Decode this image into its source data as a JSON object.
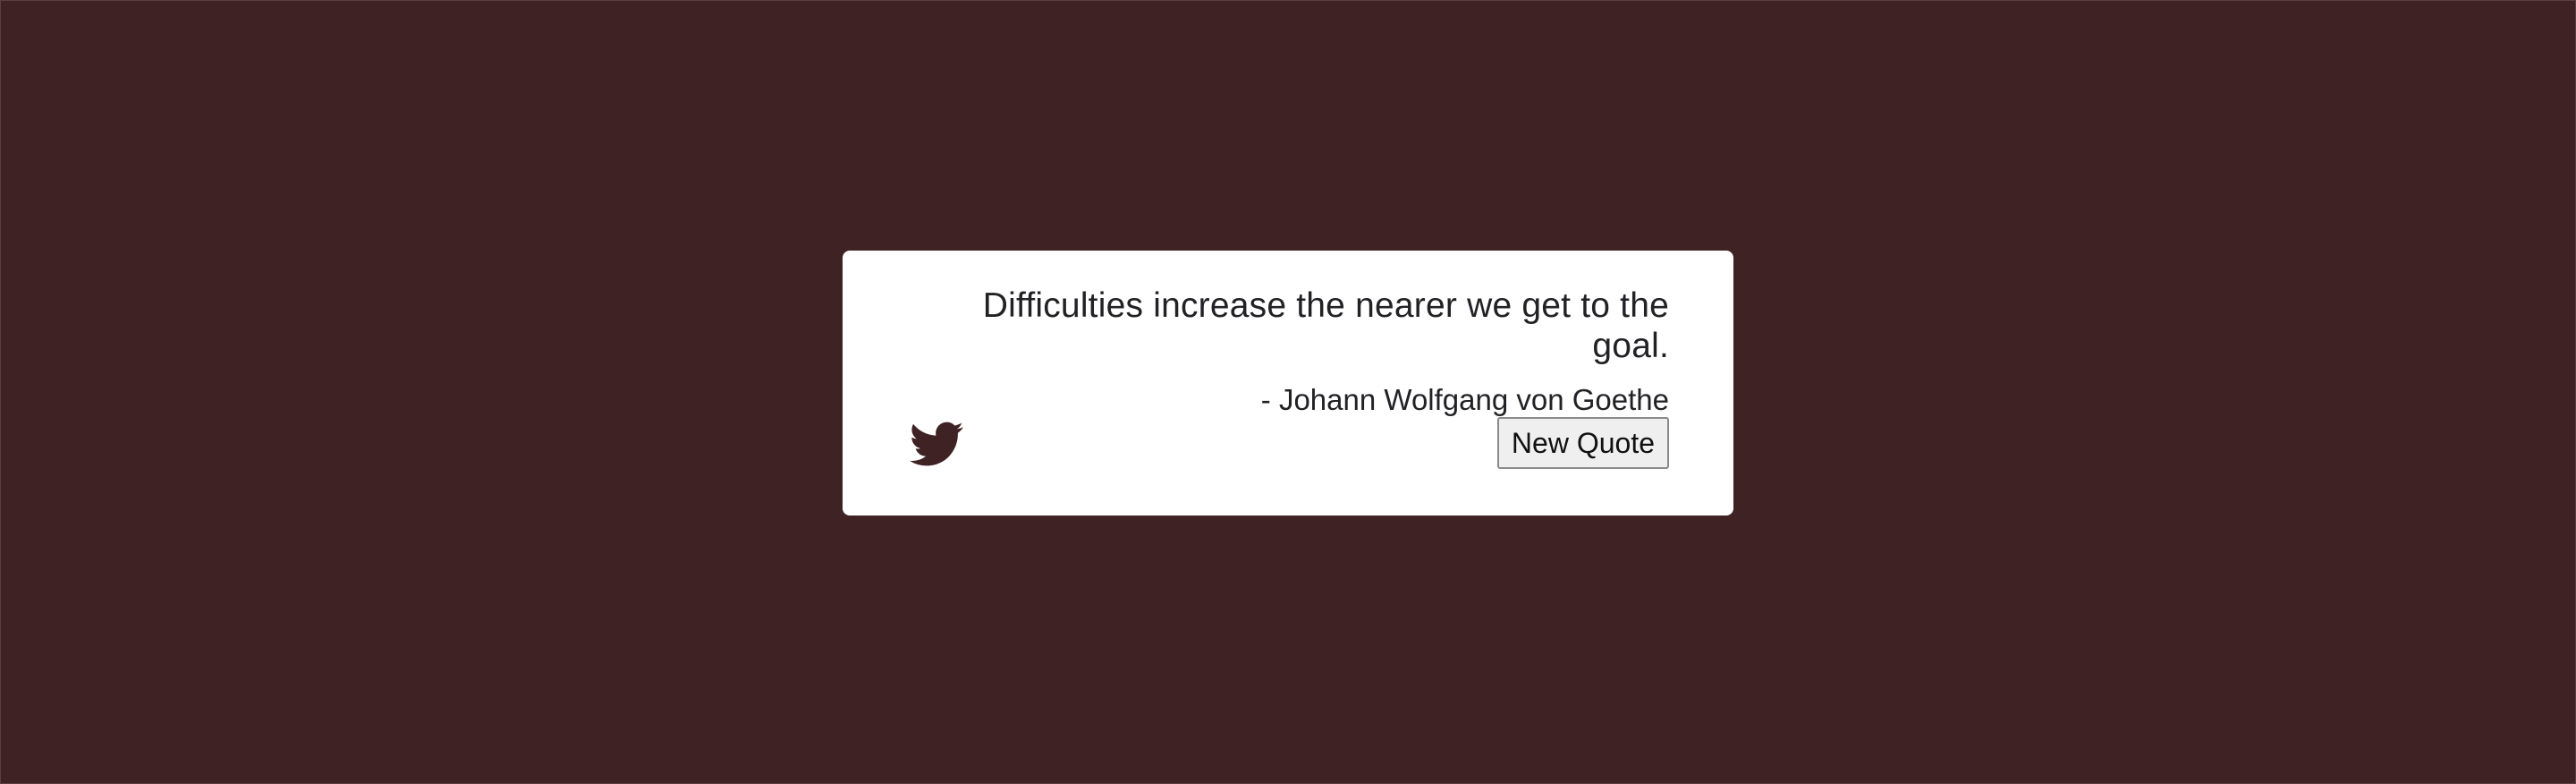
{
  "quote": {
    "text": "Difficulties increase the nearer we get to the goal.",
    "author": "- Johann Wolfgang von Goethe"
  },
  "actions": {
    "tweet_icon": "twitter-bird",
    "new_quote_label": "New Quote"
  },
  "colors": {
    "background": "#3e2224",
    "card": "#ffffff",
    "icon": "#3e2224",
    "text": "#222226"
  }
}
